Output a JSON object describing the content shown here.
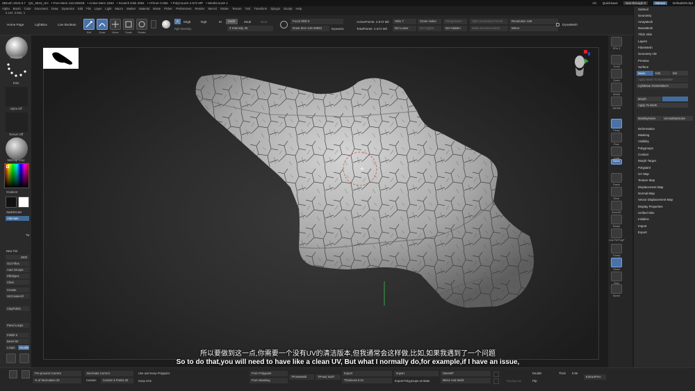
{
  "menubar": {
    "app_title": "ZBrush 2022.0.7",
    "file_name": "QS_3643_UH",
    "stats": [
      "• Free Mem 115.836GB",
      "• Active Mem 1593",
      "• Scratch Disk 2591",
      "• ATime• 0.066",
      "• PolyCount• 2.572 MP",
      "• MeshCount• 1"
    ],
    "menus": [
      "Alpha",
      "Brush",
      "Color",
      "Document",
      "Draw",
      "Dynamics",
      "Edit",
      "File",
      "Layer",
      "Light",
      "Macro",
      "Marker",
      "Material",
      "Movie",
      "Picker",
      "Preferences",
      "Render",
      "Stencil",
      "Stroke",
      "Texture",
      "Tool",
      "Transform",
      "Zplugin",
      "Zscript",
      "Help"
    ],
    "right": {
      "ac": "AC",
      "quicksave": "QuickSave",
      "seethrough": "See-through 0",
      "menus": "Menus",
      "script": "DefaultZScript"
    }
  },
  "statusbar": {
    "coords": "0.104, 0.562,-1"
  },
  "topshelf": {
    "home_page": "Home Page",
    "lightbox": "LightBox",
    "live_boolean": "Live Boolean",
    "edit": "Edit",
    "draw": "Draw",
    "move": "Move",
    "scale": "Scale",
    "rotate": "Rotate",
    "a_label": "A",
    "mrgb": "Mrgb",
    "rgb": "Rgb",
    "m": "M",
    "zadd": "Zadd",
    "zsub": "Zsub",
    "zcut": "Zcut",
    "rgb_intensity": "Rgb Intensity",
    "z_intensity": "Z Intensity 25",
    "focal_shift": "Focal Shift 0",
    "draw_size": "Draw Size 140.40994",
    "dynamic": "Dynamic",
    "active_points": "ActivePoints: 2.572 Mil",
    "total_points": "TotalPoints: 2.572 Mil",
    "sdiv": "SDiv 7",
    "del_lower": "Del Lower",
    "del_higher": "Del Higher",
    "close_holes": "Close Holes",
    "del_hidden": "Del Hidden",
    "merge_down": "MergeDown",
    "split_unmasked": "Split Unmasked Points",
    "make_boolean": "Make Boolean Mesh",
    "resolution": "Resolution 128",
    "mirror": "Mirror",
    "dynamesh": "DynaMesh"
  },
  "lefttray": {
    "standard": "Standard",
    "dots": "Dots",
    "alpha_off": "Alpha Off",
    "texture_off": "Texture Off",
    "matcap": "MatCap Gray",
    "gradient": "Gradient",
    "switch_color": "SwitchColor",
    "alternate": "Alternate",
    "tw": "Tw",
    "new_tint": "New Tint",
    "tint_val": "4000",
    "guv_tiles": "GUVTiles",
    "auto_groups": "Auto Groups",
    "fill_object": "FillObject",
    "clear": "Clear",
    "crease": "Crease",
    "uncrease_all": "UnCreaseAll",
    "clay_polish": "ClayPolish",
    "panel_loops": "Panel Loops",
    "polish": "Polish 5",
    "bevel": "Bevel 50",
    "loops": "Loops",
    "double": "Double"
  },
  "rshelf": {
    "spix": "SPix 3",
    "scroll": "Scroll",
    "zoom": "Zoom",
    "actual": "Actual",
    "aahalf": "AAHalf",
    "persp": "Persp",
    "floor": "Floor",
    "local": "Local",
    "gizmo": "Gizmo",
    "frame": "Frame",
    "move": "Move",
    "zoom3d": "Zoom3D",
    "rotate": "Rotate",
    "linefill": "Line Fill PolyF",
    "transp": "Transp",
    "ghost": "Ghost",
    "solo": "Solo",
    "xpose": "Xpose"
  },
  "rpalette": {
    "top_items": [
      "Subtool",
      "Geometry",
      "ArrayMesh",
      "NanoMesh",
      "Thick Skin",
      "Layers",
      "FiberMesh",
      "Geometry HD",
      "Preview",
      "Surface"
    ],
    "noise": "Noise",
    "edit": "Edit",
    "del": "Del",
    "apply_mask": "Apply Mask To NoiseMaker",
    "lightbox_noise": "LightBox▸ NoiseMakers",
    "morph": "Morph",
    "apply_mesh": "Apply To Mesh",
    "mask_by_noise": "MaskByNoise",
    "unmask_by_noise": "UnmaskByNoise",
    "bottom_items": [
      "Deformation",
      "Masking",
      "Visibility",
      "Polygroups",
      "Contact",
      "Morph Target",
      "Polypaint",
      "UV Map",
      "Texture Map",
      "Displacement Map",
      "Normal Map",
      "Vector Displacement Map",
      "Display Properties",
      "Unified Skin",
      "Initialize",
      "Import",
      "Export"
    ]
  },
  "bottombar": {
    "preprocess": "Pre-process Current",
    "decimate": "Decimate Current",
    "use_keep": "Use and Keep Polypaint",
    "keep_uvs": "Keep UVs",
    "pct_decimation": "% of decimation 20",
    "custom": "Custom",
    "custom_points": "Custom k Points 30",
    "from_polypaint": "From Polypaint",
    "from_masking": "From Masking",
    "tpose_mesh": "TPoseMesh",
    "tpose_subt": "TPose| SubT",
    "export": "Export",
    "thickness": "Thickness 0.01",
    "import": "Import",
    "export_polygroups": "Export Polygroups as Mats",
    "store_mt": "StoreMT",
    "mirror_weld": "Mirror And Weld",
    "replay_last": "ReplayLast",
    "double": "Double",
    "flip": "Flip",
    "thick": "Thick",
    "thick_val": "0.56",
    "extract_prev": "ExtractPrev"
  },
  "subtitles": {
    "zh": "所以要做到这一点,你需要一个没有UV的清洁版本,但我通常会这样做,比如,如果我遇到了一个问题",
    "en": "So to do that,you will need to have like a clean UV, But what I normally do,for example,if I have an issue,"
  }
}
